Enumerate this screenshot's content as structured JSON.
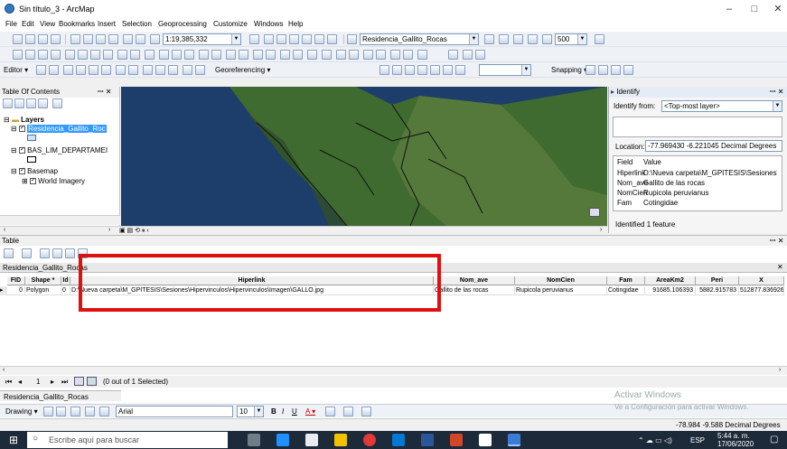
{
  "window": {
    "title": "Sin título_3 - ArcMap",
    "minimize": "–",
    "maximize": "□",
    "close": "✕"
  },
  "menu": [
    "File",
    "Edit",
    "View",
    "Bookmarks",
    "Insert",
    "Selection",
    "Geoprocessing",
    "Customize",
    "Windows",
    "Help"
  ],
  "toolbar1": {
    "scale": "1:19,385,332",
    "layer_combo": "Residencia_Gallito_Rocas",
    "size_combo": "500"
  },
  "toolbar2": {
    "editor": "Editor ▾",
    "georeferencing": "Georeferencing ▾",
    "snapping": "Snapping ▾"
  },
  "toc": {
    "title": "Table Of Contents",
    "layers_label": "Layers",
    "layer1": "Residencia_Gallito_Roc",
    "layer2": "BAS_LIM_DEPARTAMEI",
    "basemap": "Basemap",
    "world_imagery": "World Imagery"
  },
  "identify": {
    "title": "Identify",
    "from_label": "Identify from:",
    "from_value": "<Top-most layer>",
    "location_label": "Location:",
    "location_value": "-77.969430  -6.221045 Decimal Degrees",
    "field_header": "Field",
    "value_header": "Value",
    "rows": [
      {
        "field": "Hiperlink",
        "value": "D:\\Nueva carpeta\\M_GPITESIS\\Sesiones\\"
      },
      {
        "field": "Nom_ave",
        "value": "Gallito de las rocas"
      },
      {
        "field": "NomCien",
        "value": "Rupicola peruvianus"
      },
      {
        "field": "Fam",
        "value": "Cotingidae"
      }
    ],
    "footer": "Identified 1 feature"
  },
  "table": {
    "title": "Table",
    "tab_name": "Residencia_Gallito_Rocas",
    "columns": [
      "FID",
      "Shape *",
      "Id",
      "Hiperlink",
      "Nom_ave",
      "NomCien",
      "Fam",
      "AreaKm2",
      "Peri",
      "X"
    ],
    "row": [
      "0",
      "Polygon",
      "0",
      "D:\\Nueva carpeta\\M_GPITESIS\\Sesiones\\Hipervinculos\\Hipervinculos\\Imagen\\GALLO.jpg",
      "Gallito de las rocas",
      "Rupicola peruvianus",
      "Cotingidae",
      "91685.106393",
      "5882.915783",
      "512877.836926"
    ],
    "nav_record": "1",
    "selection": "(0 out of 1 Selected)",
    "bottom_tab": "Residencia_Gallito_Rocas"
  },
  "drawing": {
    "label": "Drawing ▾",
    "font": "Arial",
    "size": "10"
  },
  "status": {
    "coords": "-78.984  -9.588 Decimal Degrees",
    "activate_title": "Activar Windows",
    "activate_sub": "Ve a Configuración para activar Windows."
  },
  "taskbar": {
    "search": "Escribe aquí para buscar",
    "lang": "ESP",
    "time": "5:44 a. m.",
    "date": "17/06/2020"
  },
  "colors": {
    "highlight_box": "#e01010",
    "selected_layer": "#3399ff"
  }
}
